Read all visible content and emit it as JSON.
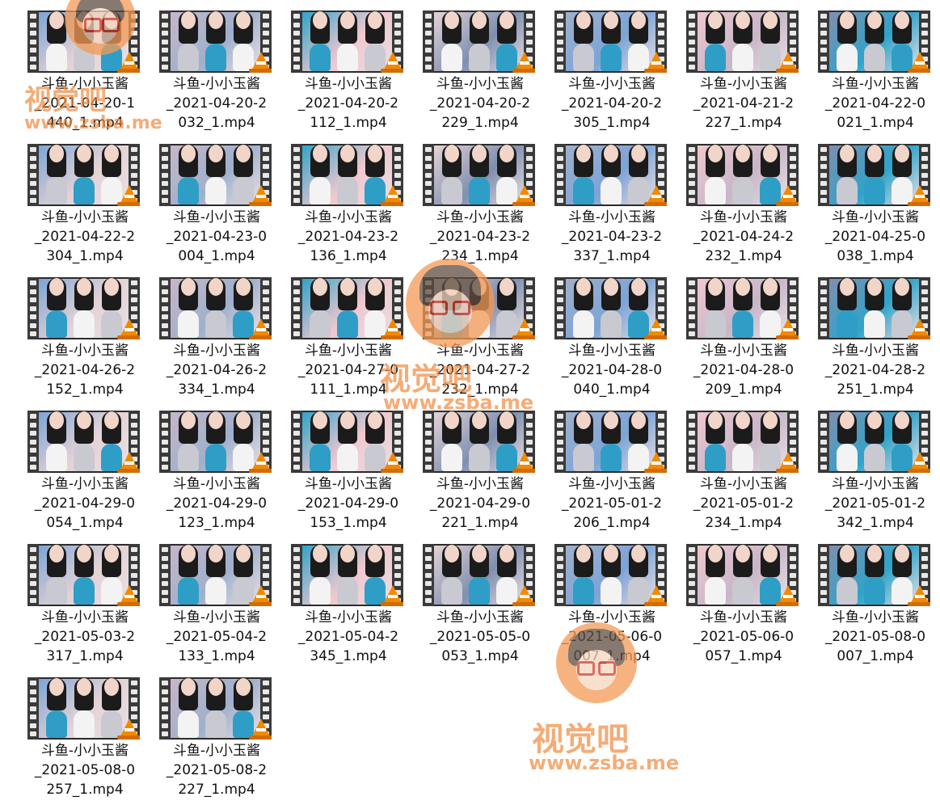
{
  "files": [
    {
      "name": "斗鱼-小小玉酱_2021-04-20-1440_1.mp4",
      "l1": "斗鱼-小小玉酱",
      "l2": "_2021-04-20-1",
      "l3": "440_1.mp4"
    },
    {
      "name": "斗鱼-小小玉酱_2021-04-20-2032_1.mp4",
      "l1": "斗鱼-小小玉酱",
      "l2": "_2021-04-20-2",
      "l3": "032_1.mp4"
    },
    {
      "name": "斗鱼-小小玉酱_2021-04-20-2112_1.mp4",
      "l1": "斗鱼-小小玉酱",
      "l2": "_2021-04-20-2",
      "l3": "112_1.mp4"
    },
    {
      "name": "斗鱼-小小玉酱_2021-04-20-2229_1.mp4",
      "l1": "斗鱼-小小玉酱",
      "l2": "_2021-04-20-2",
      "l3": "229_1.mp4"
    },
    {
      "name": "斗鱼-小小玉酱_2021-04-20-2305_1.mp4",
      "l1": "斗鱼-小小玉酱",
      "l2": "_2021-04-20-2",
      "l3": "305_1.mp4"
    },
    {
      "name": "斗鱼-小小玉酱_2021-04-21-2227_1.mp4",
      "l1": "斗鱼-小小玉酱",
      "l2": "_2021-04-21-2",
      "l3": "227_1.mp4"
    },
    {
      "name": "斗鱼-小小玉酱_2021-04-22-0021_1.mp4",
      "l1": "斗鱼-小小玉酱",
      "l2": "_2021-04-22-0",
      "l3": "021_1.mp4"
    },
    {
      "name": "斗鱼-小小玉酱_2021-04-22-2304_1.mp4",
      "l1": "斗鱼-小小玉酱",
      "l2": "_2021-04-22-2",
      "l3": "304_1.mp4"
    },
    {
      "name": "斗鱼-小小玉酱_2021-04-23-0004_1.mp4",
      "l1": "斗鱼-小小玉酱",
      "l2": "_2021-04-23-0",
      "l3": "004_1.mp4"
    },
    {
      "name": "斗鱼-小小玉酱_2021-04-23-2136_1.mp4",
      "l1": "斗鱼-小小玉酱",
      "l2": "_2021-04-23-2",
      "l3": "136_1.mp4"
    },
    {
      "name": "斗鱼-小小玉酱_2021-04-23-2234_1.mp4",
      "l1": "斗鱼-小小玉酱",
      "l2": "_2021-04-23-2",
      "l3": "234_1.mp4"
    },
    {
      "name": "斗鱼-小小玉酱_2021-04-23-2337_1.mp4",
      "l1": "斗鱼-小小玉酱",
      "l2": "_2021-04-23-2",
      "l3": "337_1.mp4"
    },
    {
      "name": "斗鱼-小小玉酱_2021-04-24-2232_1.mp4",
      "l1": "斗鱼-小小玉酱",
      "l2": "_2021-04-24-2",
      "l3": "232_1.mp4"
    },
    {
      "name": "斗鱼-小小玉酱_2021-04-25-0038_1.mp4",
      "l1": "斗鱼-小小玉酱",
      "l2": "_2021-04-25-0",
      "l3": "038_1.mp4"
    },
    {
      "name": "斗鱼-小小玉酱_2021-04-26-2152_1.mp4",
      "l1": "斗鱼-小小玉酱",
      "l2": "_2021-04-26-2",
      "l3": "152_1.mp4"
    },
    {
      "name": "斗鱼-小小玉酱_2021-04-26-2334_1.mp4",
      "l1": "斗鱼-小小玉酱",
      "l2": "_2021-04-26-2",
      "l3": "334_1.mp4"
    },
    {
      "name": "斗鱼-小小玉酱_2021-04-27-0111_1.mp4",
      "l1": "斗鱼-小小玉酱",
      "l2": "_2021-04-27-0",
      "l3": "111_1.mp4"
    },
    {
      "name": "斗鱼-小小玉酱_2021-04-27-2232_1.mp4",
      "l1": "斗鱼-小小玉酱",
      "l2": "_2021-04-27-2",
      "l3": "232_1.mp4"
    },
    {
      "name": "斗鱼-小小玉酱_2021-04-28-0040_1.mp4",
      "l1": "斗鱼-小小玉酱",
      "l2": "_2021-04-28-0",
      "l3": "040_1.mp4"
    },
    {
      "name": "斗鱼-小小玉酱_2021-04-28-0209_1.mp4",
      "l1": "斗鱼-小小玉酱",
      "l2": "_2021-04-28-0",
      "l3": "209_1.mp4"
    },
    {
      "name": "斗鱼-小小玉酱_2021-04-28-2251_1.mp4",
      "l1": "斗鱼-小小玉酱",
      "l2": "_2021-04-28-2",
      "l3": "251_1.mp4"
    },
    {
      "name": "斗鱼-小小玉酱_2021-04-29-0054_1.mp4",
      "l1": "斗鱼-小小玉酱",
      "l2": "_2021-04-29-0",
      "l3": "054_1.mp4"
    },
    {
      "name": "斗鱼-小小玉酱_2021-04-29-0123_1.mp4",
      "l1": "斗鱼-小小玉酱",
      "l2": "_2021-04-29-0",
      "l3": "123_1.mp4"
    },
    {
      "name": "斗鱼-小小玉酱_2021-04-29-0153_1.mp4",
      "l1": "斗鱼-小小玉酱",
      "l2": "_2021-04-29-0",
      "l3": "153_1.mp4"
    },
    {
      "name": "斗鱼-小小玉酱_2021-04-29-0221_1.mp4",
      "l1": "斗鱼-小小玉酱",
      "l2": "_2021-04-29-0",
      "l3": "221_1.mp4"
    },
    {
      "name": "斗鱼-小小玉酱_2021-05-01-2206_1.mp4",
      "l1": "斗鱼-小小玉酱",
      "l2": "_2021-05-01-2",
      "l3": "206_1.mp4"
    },
    {
      "name": "斗鱼-小小玉酱_2021-05-01-2234_1.mp4",
      "l1": "斗鱼-小小玉酱",
      "l2": "_2021-05-01-2",
      "l3": "234_1.mp4"
    },
    {
      "name": "斗鱼-小小玉酱_2021-05-01-2342_1.mp4",
      "l1": "斗鱼-小小玉酱",
      "l2": "_2021-05-01-2",
      "l3": "342_1.mp4"
    },
    {
      "name": "斗鱼-小小玉酱_2021-05-03-2317_1.mp4",
      "l1": "斗鱼-小小玉酱",
      "l2": "_2021-05-03-2",
      "l3": "317_1.mp4"
    },
    {
      "name": "斗鱼-小小玉酱_2021-05-04-2133_1.mp4",
      "l1": "斗鱼-小小玉酱",
      "l2": "_2021-05-04-2",
      "l3": "133_1.mp4"
    },
    {
      "name": "斗鱼-小小玉酱_2021-05-04-2345_1.mp4",
      "l1": "斗鱼-小小玉酱",
      "l2": "_2021-05-04-2",
      "l3": "345_1.mp4"
    },
    {
      "name": "斗鱼-小小玉酱_2021-05-05-0053_1.mp4",
      "l1": "斗鱼-小小玉酱",
      "l2": "_2021-05-05-0",
      "l3": "053_1.mp4"
    },
    {
      "name": "斗鱼-小小玉酱_2021-05-06-0007_1.mp4",
      "l1": "斗鱼-小小玉酱",
      "l2": "_2021-05-06-0",
      "l3": "007_1.mp4"
    },
    {
      "name": "斗鱼-小小玉酱_2021-05-06-0057_1.mp4",
      "l1": "斗鱼-小小玉酱",
      "l2": "_2021-05-06-0",
      "l3": "057_1.mp4"
    },
    {
      "name": "斗鱼-小小玉酱_2021-05-08-0007_1.mp4",
      "l1": "斗鱼-小小玉酱",
      "l2": "_2021-05-08-0",
      "l3": "007_1.mp4"
    },
    {
      "name": "斗鱼-小小玉酱_2021-05-08-0257_1.mp4",
      "l1": "斗鱼-小小玉酱",
      "l2": "_2021-05-08-0",
      "l3": "257_1.mp4"
    },
    {
      "name": "斗鱼-小小玉酱_2021-05-08-2227_1.mp4",
      "l1": "斗鱼-小小玉酱",
      "l2": "_2021-05-08-2",
      "l3": "227_1.mp4"
    }
  ],
  "thumb_palette": [
    "#7da4d6",
    "#c7b6c8",
    "#2fa3c9",
    "#e4d3d6",
    "#9eb0cc",
    "#f0c7cf",
    "#7f8fb0"
  ],
  "file_icon": "vlc-cone-icon",
  "watermark": {
    "text_cn": "视觉吧",
    "text_url": "www.zsba.me",
    "color": "#f08a3e"
  }
}
